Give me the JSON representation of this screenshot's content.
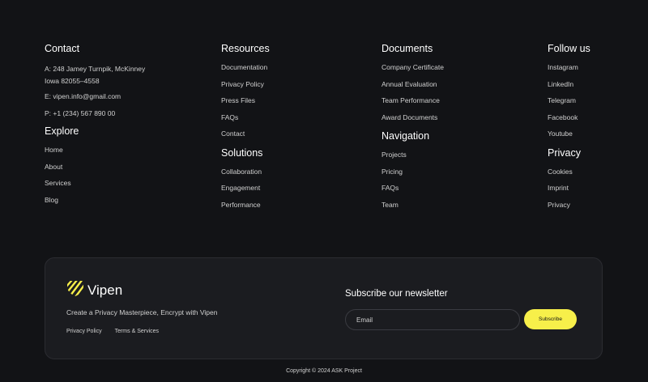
{
  "contact": {
    "title": "Contact",
    "address_line1": "A: 248 Jamey Turnpik, McKinney",
    "address_line2": "Iowa 82055–4558",
    "email": "E: vipen.info@gmail.com",
    "phone": "P: +1 (234) 567 890 00"
  },
  "explore": {
    "title": "Explore",
    "items": [
      "Home",
      "About",
      "Services",
      "Blog"
    ]
  },
  "resources": {
    "title": "Resources",
    "items": [
      "Documentation",
      "Privacy Policy",
      "Press Files",
      "FAQs",
      "Contact"
    ]
  },
  "solutions": {
    "title": "Solutions",
    "items": [
      "Collaboration",
      "Engagement",
      "Performance"
    ]
  },
  "documents": {
    "title": "Documents",
    "items": [
      "Company Certificate",
      "Annual Evaluation",
      "Team Performance",
      "Award Documents"
    ]
  },
  "navigation": {
    "title": "Navigation",
    "items": [
      "Projects",
      "Pricing",
      "FAQs",
      "Team"
    ]
  },
  "follow": {
    "title": "Follow us",
    "items": [
      "Instagram",
      "LinkedIn",
      "Telegram",
      "Facebook",
      "Youtube"
    ]
  },
  "privacy": {
    "title": "Privacy",
    "items": [
      "Cookies",
      "Imprint",
      "Privacy"
    ]
  },
  "card": {
    "brand": "Vipen",
    "logo_icon": "striped-shield-icon",
    "tagline": "Create a Privacy Masterpiece, Encrypt with Vipen",
    "links": [
      "Privacy Policy",
      "Terms & Services"
    ],
    "newsletter_title": "Subscribe our newsletter",
    "email_placeholder": "Email",
    "subscribe_label": "Subscribe"
  },
  "copyright": "Copyright © 2024 ASK Project",
  "colors": {
    "background": "#121316",
    "card": "#1b1c20",
    "accent": "#f7ef4a"
  }
}
